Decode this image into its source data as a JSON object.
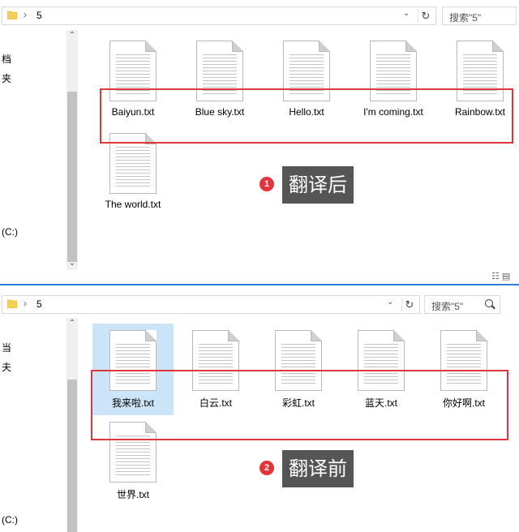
{
  "top": {
    "path": "5",
    "search_placeholder": "搜索\"5\"",
    "nav_items": [
      "档",
      "夹",
      "(C:)"
    ],
    "files": [
      "Baiyun.txt",
      "Blue sky.txt",
      "Hello.txt",
      "I'm coming.txt",
      "Rainbow.txt",
      "The world.txt"
    ],
    "badge": "1",
    "tag": "翻译后"
  },
  "bottom": {
    "path": "5",
    "search_placeholder": "搜索\"5\"",
    "nav_items": [
      "当",
      "夫",
      "(C:)"
    ],
    "files": [
      "我来啦.txt",
      "白云.txt",
      "彩虹.txt",
      "蓝天.txt",
      "你好啊.txt",
      "世界.txt"
    ],
    "badge": "2",
    "tag": "翻译前"
  },
  "icons": {
    "folder": "folder-icon",
    "chevron": "chevron-right-icon",
    "dropdown": "chevron-down-icon",
    "refresh": "refresh-icon",
    "search": "search-icon"
  },
  "colors": {
    "annotation_red": "#e0353b",
    "tag_bg": "#555555",
    "selection": "#cce4f7",
    "separator": "#2b80d6"
  }
}
